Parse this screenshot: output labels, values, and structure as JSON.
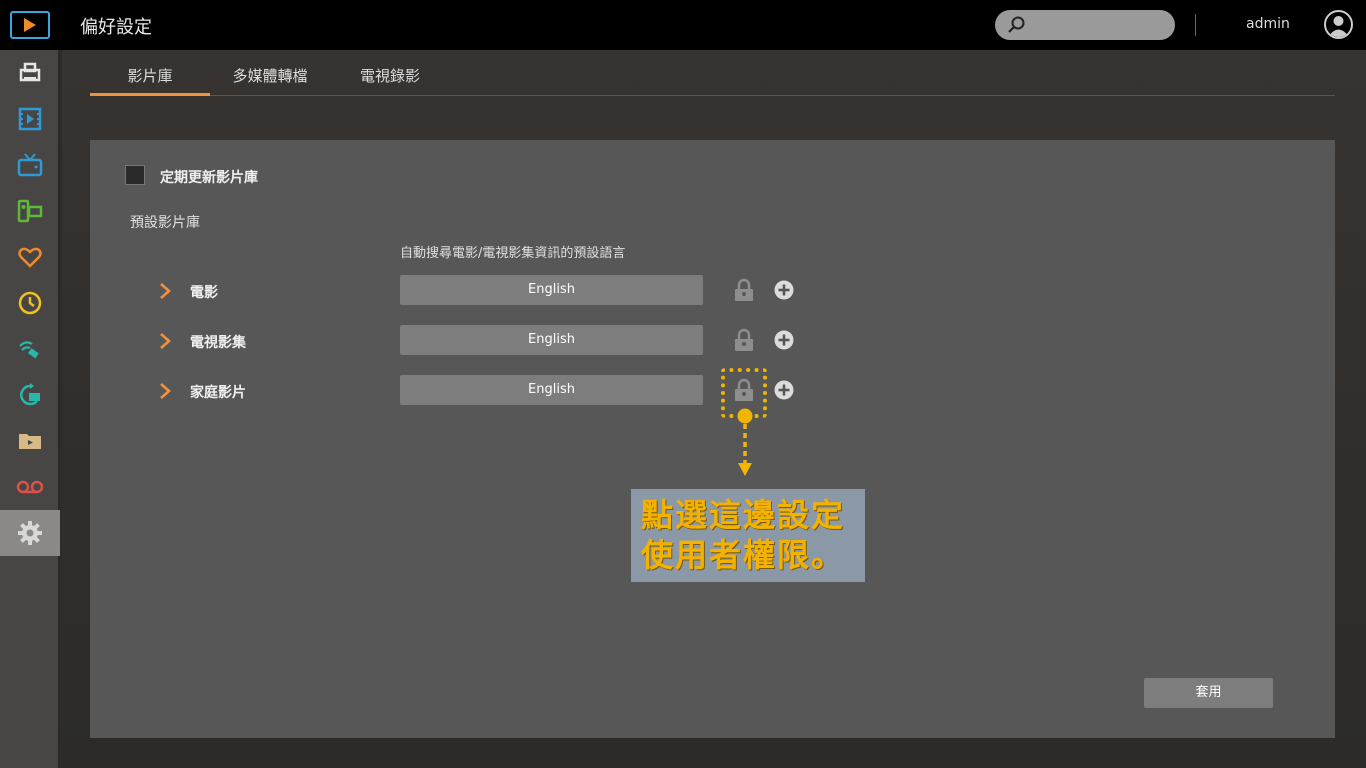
{
  "header": {
    "title": "偏好設定",
    "search_placeholder": "",
    "user": "admin"
  },
  "sidebar": {
    "items": [
      {
        "icon": "share-device-icon",
        "color": "#e6e6e6"
      },
      {
        "icon": "film-icon",
        "color": "#2f9ad6"
      },
      {
        "icon": "tv-icon",
        "color": "#2f9ad6"
      },
      {
        "icon": "camcorder-icon",
        "color": "#5fb83a"
      },
      {
        "icon": "heart-icon",
        "color": "#f08a2a"
      },
      {
        "icon": "clock-icon",
        "color": "#f0c020"
      },
      {
        "icon": "wireless-transfer-icon",
        "color": "#2ab7a9"
      },
      {
        "icon": "transcode-icon",
        "color": "#2ab7a9"
      },
      {
        "icon": "folder-video-icon",
        "color": "#d7b887"
      },
      {
        "icon": "voicemail-record-icon",
        "color": "#e0504a"
      },
      {
        "icon": "gear-icon",
        "color": "#d8d8d8",
        "active": true
      }
    ]
  },
  "tabs": [
    {
      "label": "影片庫",
      "active": true
    },
    {
      "label": "多媒體轉檔",
      "active": false
    },
    {
      "label": "電視錄影",
      "active": false
    }
  ],
  "panel": {
    "auto_update_label": "定期更新影片庫",
    "auto_update_checked": false,
    "default_library_label": "預設影片庫",
    "language_header": "自動搜尋電影/電視影集資訊的預設語言",
    "rows": [
      {
        "label": "電影",
        "language": "English"
      },
      {
        "label": "電視影集",
        "language": "English"
      },
      {
        "label": "家庭影片",
        "language": "English"
      }
    ],
    "apply_label": "套用"
  },
  "annotation": {
    "line1": "點選這邊設定",
    "line2": "使用者權限。",
    "color": "#f3b100"
  }
}
